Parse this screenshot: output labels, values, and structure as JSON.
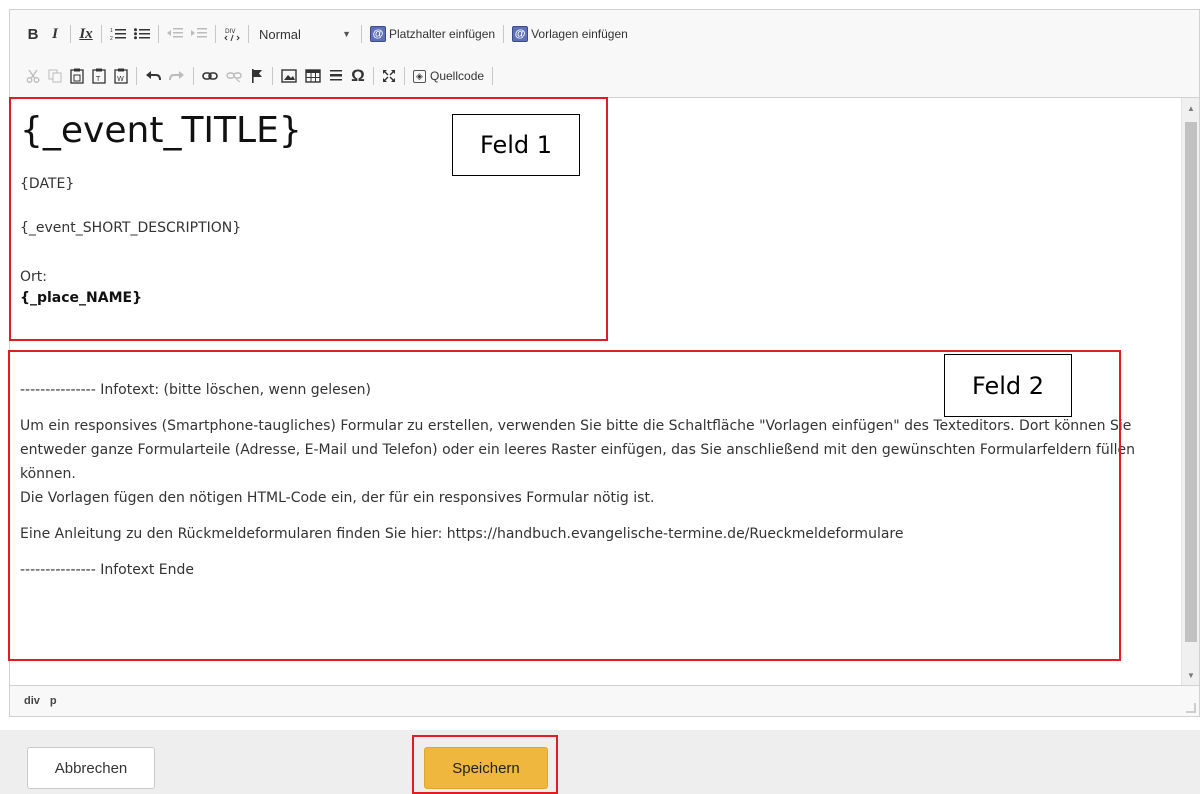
{
  "toolbar": {
    "bold": "B",
    "italic": "I",
    "remove_format": "Ix",
    "format_select": "Normal",
    "placeholder_button": "Platzhalter einfügen",
    "template_button": "Vorlagen einfügen",
    "plugin_glyph": "@",
    "source_button": "Quellcode"
  },
  "content": {
    "title": "{_event_TITLE}",
    "date": "{DATE}",
    "short_description": "{_event_SHORT_DESCRIPTION}",
    "place_label": "Ort:",
    "place_name": "{_place_NAME}",
    "info_paragraphs": [
      "--------------- Infotext: (bitte löschen, wenn gelesen)",
      "Um ein responsives (Smartphone-taugliches) Formular zu erstellen, verwenden Sie bitte die Schaltfläche \"Vorlagen einfügen\" des Texteditors. Dort können Sie entweder ganze Formularteile (Adresse, E-Mail und Telefon) oder ein leeres Raster einfügen, das Sie anschließend mit den gewünschten Formularfeldern füllen können.",
      "Die Vorlagen fügen den nötigen HTML-Code ein, der für ein responsives Formular nötig ist.",
      "Eine Anleitung zu den Rückmeldeformularen finden Sie hier: https://handbuch.evangelische-termine.de/Rueckmeldeformulare",
      "--------------- Infotext Ende"
    ]
  },
  "statusbar": {
    "path": [
      "div",
      "p"
    ]
  },
  "annotations": {
    "feld1": "Feld 1",
    "feld2": "Feld 2"
  },
  "footer": {
    "cancel_label": "Abbrechen",
    "save_label": "Speichern"
  },
  "colors": {
    "save_button": "#f0b73e",
    "annotation_red": "#e31b23",
    "plugin_icon": "#5f6fb8"
  }
}
